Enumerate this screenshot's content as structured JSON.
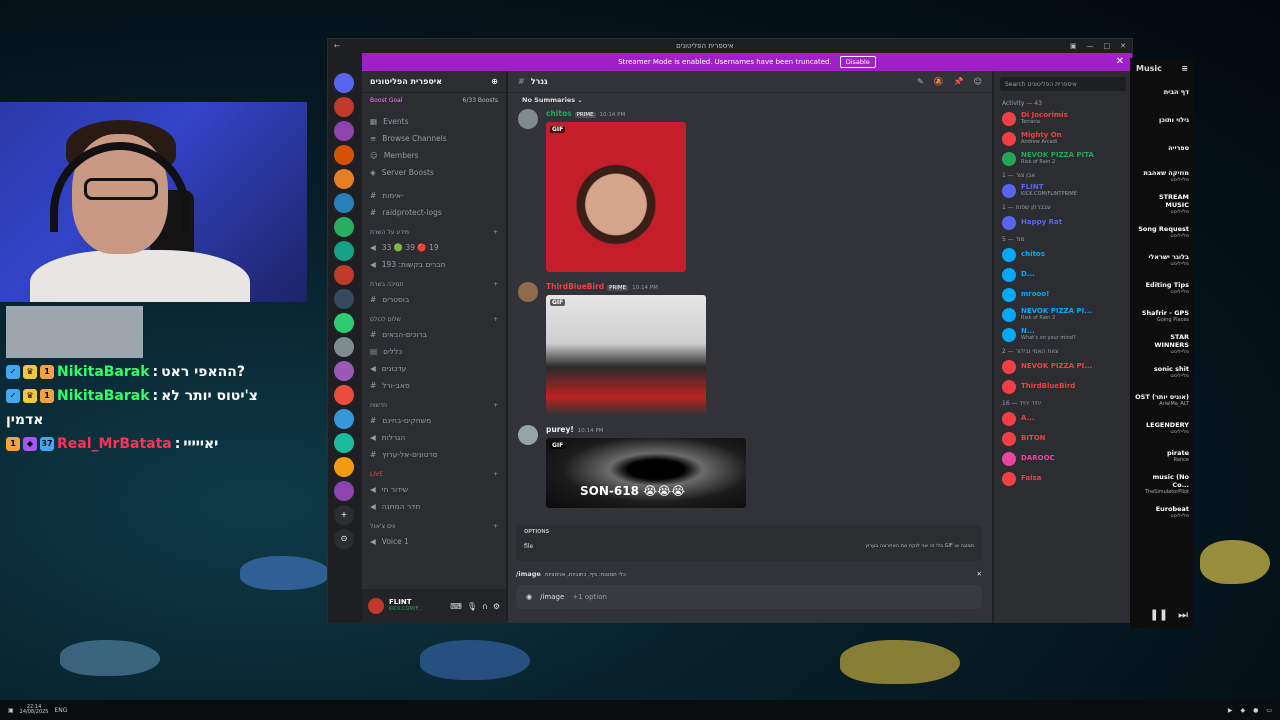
{
  "window": {
    "title": "איספרית הפליטונים"
  },
  "banner": {
    "text": "Streamer Mode is enabled. Usernames have been truncated.",
    "disable": "Disable"
  },
  "server": {
    "name": "איספרית הפליטונים",
    "boost_goal": "Boost Goal",
    "boost_count": "6/33 Boosts"
  },
  "nav": {
    "events": "Events",
    "browse": "Browse Channels",
    "members": "Members",
    "boosts": "Server Boosts"
  },
  "channels": [
    {
      "icon": "#",
      "label": "אימות-"
    },
    {
      "icon": "#",
      "label": "raidprotect-logs"
    }
  ],
  "cats": [
    {
      "title": "מידע על השרת",
      "items": [
        "33 🟢 39 🔴 19",
        "חברים בקשות: 193"
      ]
    },
    {
      "title": "תמיכה בשרת",
      "items": [
        "בוסטרים"
      ]
    },
    {
      "title": "שלום לכולם",
      "items": [
        "ברוכים-הבאים",
        "כללים",
        "עדכונים",
        "סאב-ורל"
      ]
    },
    {
      "title": "חדשות",
      "items": [
        "משחקים-בחינם",
        "הגרלות",
        "סרטונים-אל-ערוץ"
      ]
    },
    {
      "title": "LIVE",
      "items": [
        "שידור חי",
        "חדר המתנה"
      ]
    },
    {
      "title": "ווים צ'אנל",
      "items": [
        "Voice 1"
      ]
    }
  ],
  "user": {
    "name": "FLINT",
    "sub": "KICK.COM/F..."
  },
  "main": {
    "channel": "גנרל",
    "summaries": "No Summaries",
    "messages": [
      {
        "user": "chitos",
        "tag": "PRIME",
        "time": "10:14 PM",
        "color": "#23a559"
      },
      {
        "user": "ThirdBlueBird",
        "tag": "PRIME",
        "time": "10:14 PM",
        "color": "#f23f43"
      },
      {
        "user": "purey!",
        "tag": "",
        "time": "10:14 PM",
        "color": "#f2f3f5"
      }
    ],
    "gif_label": "GIF",
    "gif_caption": "SON-618 😭😭😭",
    "options_title": "OPTIONS",
    "options_file": "file",
    "options_desc": "בלי זה אני לוקח את האחרונה בערוץ GIF תמונה או",
    "cmd_name": "/image",
    "cmd_desc": "כלי תמונות: גיף, כתוביות, אנימציות",
    "input_cmd": "/image",
    "input_opt": "+1 option"
  },
  "members": {
    "search": "Search איספרית הפליטונים",
    "activity": "Activity — 43",
    "list": [
      {
        "group": "",
        "name": "Di Jocorimis",
        "sub": "Terraria",
        "color": "#f23f43"
      },
      {
        "group": "",
        "name": "Mighty On",
        "sub": "Andrew Arcadi",
        "color": "#f23f43"
      },
      {
        "group": "",
        "name": "NEVOK PIZZA PITA",
        "sub": "Risk of Rain 2",
        "color": "#23a559"
      },
      {
        "group": "אבן צור — 1",
        "name": "FLINT",
        "sub": "KICK.COM/FLINTPRIME",
        "color": "#5865f2"
      },
      {
        "group": "עבברתן שפות — 1",
        "name": "Happy Rat",
        "sub": "",
        "color": "#5865f2"
      },
      {
        "group": "מוד — 5",
        "name": "chitos",
        "sub": "",
        "color": "#00a8fc"
      },
      {
        "group": "",
        "name": "D...",
        "sub": "",
        "color": "#00a8fc"
      },
      {
        "group": "",
        "name": "mrooo!",
        "sub": "",
        "color": "#00a8fc"
      },
      {
        "group": "",
        "name": "NEVOK PIZZA PI...",
        "sub": "Risk of Rain 2",
        "color": "#00a8fc"
      },
      {
        "group": "",
        "name": "N...",
        "sub": "What's on your mind?",
        "color": "#00a8fc"
      },
      {
        "group": "צוות האמי ובידור — 2",
        "name": "NEVOK PIZZA PI...",
        "sub": "",
        "color": "#f23f43"
      },
      {
        "group": "",
        "name": "ThirdBlueBird",
        "sub": "",
        "color": "#f23f43"
      },
      {
        "group": "יחיד יחיד — 16",
        "name": "A...",
        "sub": "",
        "color": "#f23f43"
      },
      {
        "group": "",
        "name": "BITON",
        "sub": "",
        "color": "#f23f43"
      },
      {
        "group": "",
        "name": "DAROOC",
        "sub": "",
        "color": "#eb459e"
      },
      {
        "group": "",
        "name": "Faisa",
        "sub": "",
        "color": "#f23f43"
      }
    ]
  },
  "chat": [
    {
      "user": "NikitaBarak",
      "msg": "ההאפי ראט?",
      "color": "#33ff66"
    },
    {
      "user": "NikitaBarak",
      "msg": "צ'יטוס יותר לא",
      "color": "#33ff66"
    },
    {
      "user": "",
      "msg": "אדמין",
      "color": "#33ff66"
    },
    {
      "user": "Real_MrBatata",
      "msg": "יאייייי",
      "color": "#ff3355"
    }
  ],
  "spotify": {
    "title": "Music",
    "items": [
      {
        "t": "דף הבית",
        "s": ""
      },
      {
        "t": "גילוי ותוכן",
        "s": ""
      },
      {
        "t": "ספרייה",
        "s": ""
      },
      {
        "t": "מוזיקה שאהבת",
        "s": "פלייליסט"
      },
      {
        "t": "STREAM MUSIC",
        "s": "פלייליסט"
      },
      {
        "t": "Song Request",
        "s": "פלייליסט"
      },
      {
        "t": "בלוגר ישראלי",
        "s": "פלייליסט"
      },
      {
        "t": "Editing Tips",
        "s": "פלייליסט"
      },
      {
        "t": "Shafrir - GPS",
        "s": "Going Places"
      },
      {
        "t": "STAR WINNERS",
        "s": "פלייליסט"
      },
      {
        "t": "sonic shit",
        "s": "פלייליסט"
      },
      {
        "t": "OST (אוניס יותר)",
        "s": "ArielMe_ALT"
      },
      {
        "t": "LEGENDERY",
        "s": "פלייליסט"
      },
      {
        "t": "pirate",
        "s": "Rance"
      },
      {
        "t": "music (No Co...",
        "s": "TheSimulatorPilot"
      },
      {
        "t": "Eurobeat",
        "s": "פלייליסט"
      }
    ]
  },
  "taskbar": {
    "time": "22:14",
    "date": "24/08/2025",
    "lang": "ENG"
  }
}
